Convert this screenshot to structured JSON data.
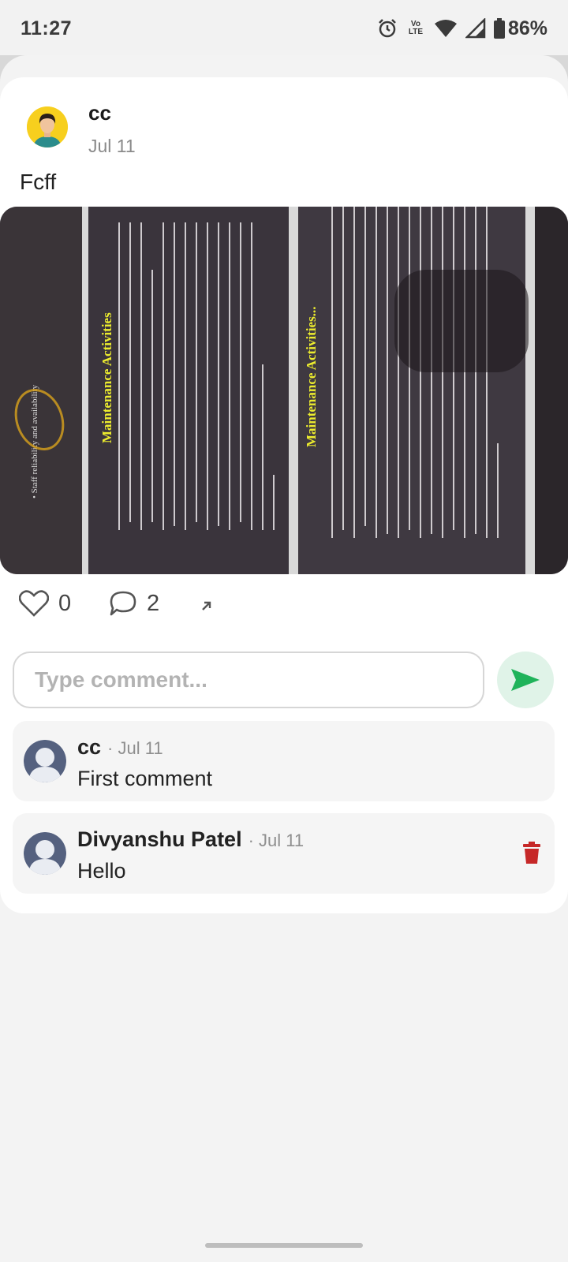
{
  "status_bar": {
    "time": "11:27",
    "lte": "Vo LTE",
    "battery": "86%",
    "icons": [
      "alarm-icon",
      "volte-icon",
      "wifi-icon",
      "signal-icon",
      "battery-icon"
    ]
  },
  "post": {
    "author": "cc",
    "date": "Jul 11",
    "text": "Fcff",
    "image": {
      "slide_left_heading": "Maintenance Activities",
      "slide_right_heading": "Maintenance Activities..."
    },
    "likes": "0",
    "comments_count": "2"
  },
  "comment_box": {
    "placeholder": "Type comment...",
    "value": ""
  },
  "comments": [
    {
      "author": "cc",
      "date": "· Jul 11",
      "text": "First comment",
      "deletable": false
    },
    {
      "author": "Divyanshu Patel",
      "date": "· Jul 11",
      "text": "Hello",
      "deletable": true
    }
  ],
  "colors": {
    "send_bg": "#e0f3e8",
    "send_icon": "#1fb35a",
    "delete_icon": "#c62828",
    "avatar_bg": "#f7cf1e"
  }
}
